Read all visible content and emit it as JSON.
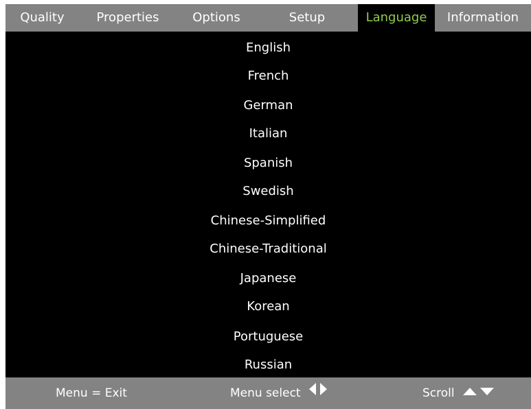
{
  "tabs": [
    {
      "label": "Quality",
      "active": false
    },
    {
      "label": "Properties",
      "active": false
    },
    {
      "label": "Options",
      "active": false
    },
    {
      "label": "Setup",
      "active": false
    },
    {
      "label": "Language",
      "active": true
    },
    {
      "label": "Information",
      "active": false
    }
  ],
  "languages": [
    "English",
    "French",
    "German",
    "Italian",
    "Spanish",
    "Swedish",
    "Chinese-Simplified",
    "Chinese-Traditional",
    "Japanese",
    "Korean",
    "Portuguese",
    "Russian"
  ],
  "footer": {
    "exit_label": "Menu = Exit",
    "select_label": "Menu select",
    "select_icon": "left-right-arrows-icon",
    "scroll_label": "Scroll",
    "scroll_icon": "up-down-arrows-icon"
  },
  "colors": {
    "bar_background": "#838383",
    "screen_background": "#000000",
    "active_tab_text": "#8fcd4c",
    "text": "#ffffff"
  }
}
